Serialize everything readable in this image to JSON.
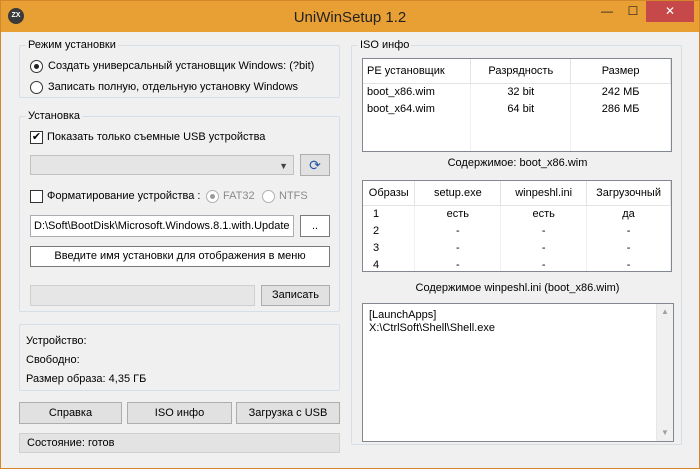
{
  "window": {
    "title": "UniWinSetup 1.2",
    "logo_text": "ZX",
    "min_glyph": "—",
    "max_glyph": "☐",
    "close_glyph": "✕"
  },
  "mode_group": {
    "title": "Режим установки",
    "options": [
      {
        "label": "Создать универсальный установщик Windows: (?bit)",
        "checked": true
      },
      {
        "label": "Записать полную, отдельную установку Windows",
        "checked": false
      }
    ]
  },
  "install_group": {
    "title": "Установка",
    "usb_only_label": "Показать только съемные USB устройства",
    "usb_only_checked": true,
    "usb_only_mark": "✔",
    "device_select_value": "",
    "refresh_icon_glyph": "⟳",
    "format_label": "Форматирование устройства :",
    "format_checked": false,
    "fat32_label": "FAT32",
    "ntfs_label": "NTFS",
    "path_value": "D:\\Soft\\BootDisk\\Microsoft.Windows.8.1.with.Update",
    "browse_label": "..",
    "menu_name_label": "Введите имя установки для отображения в меню",
    "write_label": "Записать"
  },
  "device_info": {
    "device_label": "Устройство:",
    "free_label": "Свободно:",
    "image_size_label": "Размер образа: 4,35 ГБ"
  },
  "bottom_buttons": {
    "help": "Справка",
    "iso_info": "ISO инфо",
    "usb_boot": "Загрузка с USB"
  },
  "status": "Состояние: готов",
  "iso_group": {
    "title": "ISO инфо",
    "pe_table": {
      "headers": [
        "PE установщик",
        "Разрядность",
        "Размер"
      ],
      "rows": [
        [
          "boot_x86.wim",
          "32 bit",
          "242 МБ"
        ],
        [
          "boot_x64.wim",
          "64 bit",
          "286 МБ"
        ]
      ]
    },
    "contents_caption": "Содержимое: boot_x86.wim",
    "images_table": {
      "headers": [
        "Образы",
        "setup.exe",
        "winpeshl.ini",
        "Загрузочный"
      ],
      "rows": [
        [
          "1",
          "есть",
          "есть",
          "да"
        ],
        [
          "2",
          "-",
          "-",
          "-"
        ],
        [
          "3",
          "-",
          "-",
          "-"
        ],
        [
          "4",
          "-",
          "-",
          "-"
        ]
      ]
    },
    "winpeshl_caption": "Содержимое winpeshl.ini (boot_x86.wim)",
    "winpeshl_lines": [
      "[LaunchApps]",
      "X:\\CtrlSoft\\Shell\\Shell.exe"
    ],
    "scroll_up_glyph": "▲",
    "scroll_down_glyph": "▼"
  }
}
